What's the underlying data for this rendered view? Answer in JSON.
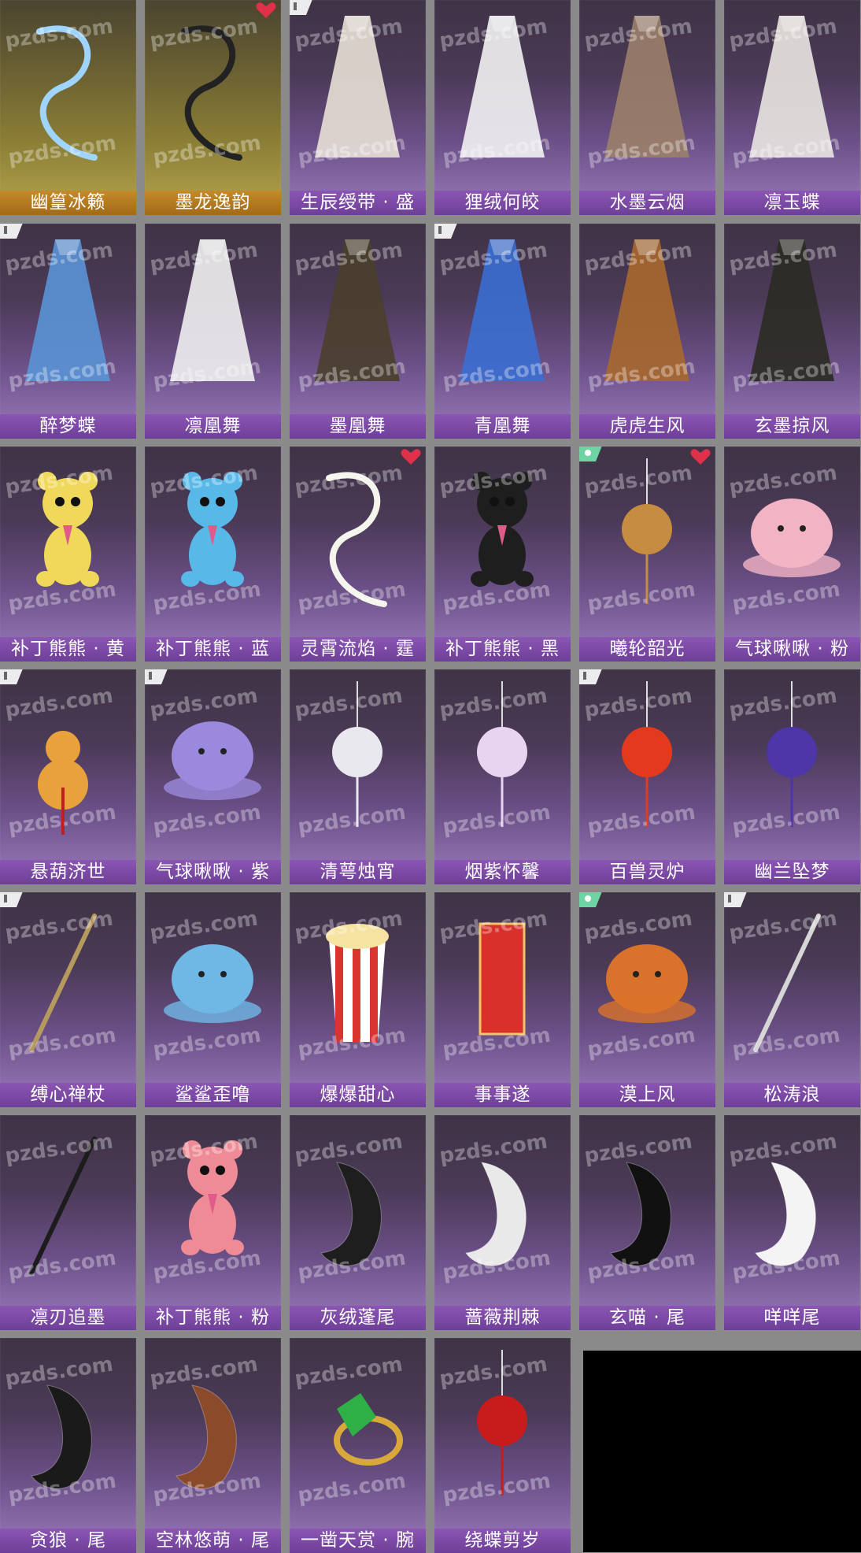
{
  "watermark": "pzds.com",
  "items": [
    {
      "name": "幽篁冰籁",
      "color": "#9fd4ff",
      "gold": true,
      "icon": "ice-dragon-icon"
    },
    {
      "name": "墨龙逸韵",
      "color": "#222222",
      "gold": true,
      "heart": true,
      "icon": "ink-dragon-icon"
    },
    {
      "name": "生辰绶带 · 盛",
      "color": "#e8e0d6",
      "new": true,
      "icon": "ribbon-sash-icon"
    },
    {
      "name": "狸绒何皎",
      "color": "#f2f2f2",
      "icon": "white-wig-icon"
    },
    {
      "name": "水墨云烟",
      "color": "#9b7f69",
      "icon": "ink-robe-icon"
    },
    {
      "name": "凛玉蝶",
      "color": "#e9e6e1",
      "icon": "jade-butterfly-outfit-icon"
    },
    {
      "name": "醉梦蝶",
      "color": "#5a94d6",
      "new": true,
      "icon": "blue-butterfly-outfit-icon"
    },
    {
      "name": "凛凰舞",
      "color": "#efefef",
      "icon": "white-phoenix-outfit-icon"
    },
    {
      "name": "墨凰舞",
      "color": "#4a3f2c",
      "icon": "dark-phoenix-outfit-icon"
    },
    {
      "name": "青凰舞",
      "color": "#3b6ed1",
      "new": true,
      "icon": "blue-phoenix-outfit-icon"
    },
    {
      "name": "虎虎生风",
      "color": "#a8682d",
      "icon": "tiger-costume-icon"
    },
    {
      "name": "玄墨掠风",
      "color": "#2b2b24",
      "icon": "dark-cape-icon"
    },
    {
      "name": "补丁熊熊 · 黄",
      "color": "#f0d85a",
      "icon": "teddy-bear-yellow-icon"
    },
    {
      "name": "补丁熊熊 · 蓝",
      "color": "#58b8e8",
      "icon": "teddy-bear-blue-icon"
    },
    {
      "name": "灵霄流焰 · 霆",
      "color": "#f5f5ee",
      "heart": true,
      "icon": "lightning-aura-icon"
    },
    {
      "name": "补丁熊熊 · 黑",
      "color": "#1e1e1e",
      "icon": "teddy-bear-black-icon"
    },
    {
      "name": "曦轮韶光",
      "color": "#c68c3f",
      "green": true,
      "heart": true,
      "icon": "golden-halo-icon"
    },
    {
      "name": "气球啾啾 · 粉",
      "color": "#f2b4c4",
      "icon": "pink-balloon-blob-icon"
    },
    {
      "name": "悬葫济世",
      "color": "#e9a23b",
      "new": true,
      "icon": "gourd-icon"
    },
    {
      "name": "气球啾啾 · 紫",
      "color": "#9a89dc",
      "new": true,
      "icon": "purple-balloon-blob-icon"
    },
    {
      "name": "清萼烛宵",
      "color": "#e8e8ee",
      "icon": "lotus-lamp-icon"
    },
    {
      "name": "烟紫怀馨",
      "color": "#e8d3f0",
      "icon": "purple-sachet-icon"
    },
    {
      "name": "百兽灵炉",
      "color": "#e33a1d",
      "new": true,
      "icon": "flame-censer-icon"
    },
    {
      "name": "幽兰坠梦",
      "color": "#4d36a8",
      "icon": "orchid-pendant-icon"
    },
    {
      "name": "缚心禅杖",
      "color": "#b69a5d",
      "new": true,
      "icon": "zen-staff-icon"
    },
    {
      "name": "鲨鲨歪噜",
      "color": "#6fb8e6",
      "icon": "shark-plush-icon"
    },
    {
      "name": "爆爆甜心",
      "color": "#d8352f",
      "icon": "popcorn-icon"
    },
    {
      "name": "事事遂",
      "color": "#d9302c",
      "icon": "red-scroll-icon"
    },
    {
      "name": "漠上风",
      "color": "#d9722b",
      "green": true,
      "icon": "owl-icon"
    },
    {
      "name": "松涛浪",
      "color": "#d6d6d6",
      "new": true,
      "icon": "flute-icon"
    },
    {
      "name": "凛刃追墨",
      "color": "#1c1c1c",
      "icon": "black-sword-icon"
    },
    {
      "name": "补丁熊熊 · 粉",
      "color": "#ee8b96",
      "icon": "teddy-bear-pink-icon"
    },
    {
      "name": "灰绒蓬尾",
      "color": "#1e1e1e",
      "icon": "fluffy-black-tail-icon"
    },
    {
      "name": "蔷薇荆棘",
      "color": "#e9e9e9",
      "icon": "rose-thorn-tail-icon"
    },
    {
      "name": "玄喵 · 尾",
      "color": "#111111",
      "icon": "black-cat-tail-icon"
    },
    {
      "name": "咩咩尾",
      "color": "#f4f4f4",
      "icon": "white-tail-icon"
    },
    {
      "name": "贪狼 · 尾",
      "color": "#1a1a1a",
      "icon": "wolf-tail-icon"
    },
    {
      "name": "空林悠萌 · 尾",
      "color": "#8b4a2a",
      "icon": "raccoon-tail-icon"
    },
    {
      "name": "一凿天赏 · 腕",
      "color": "#2fb047",
      "icon": "emerald-bracelet-icon"
    },
    {
      "name": "绕蝶剪岁",
      "color": "#c81b1b",
      "icon": "red-butterfly-hairpin-icon"
    }
  ]
}
